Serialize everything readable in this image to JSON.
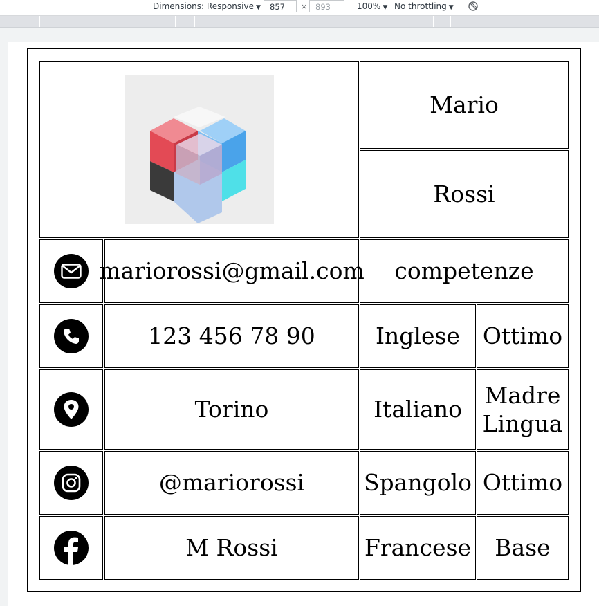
{
  "devtools": {
    "dimensions_label": "Dimensions: Responsive",
    "width_value": "857",
    "height_placeholder": "893",
    "times": "×",
    "zoom": "100%",
    "throttling": "No throttling",
    "caret": "▼"
  },
  "profile": {
    "first_name": "Mario",
    "last_name": "Rossi",
    "photo_icon": "glass-cube-image"
  },
  "contacts": [
    {
      "icon": "email-icon",
      "value": "mariorossi@gmail.com"
    },
    {
      "icon": "phone-icon",
      "value": "123 456 78 90"
    },
    {
      "icon": "location-icon",
      "value": "Torino"
    },
    {
      "icon": "instagram-icon",
      "value": "@mariorossi"
    },
    {
      "icon": "facebook-icon",
      "value": "M Rossi"
    }
  ],
  "skills": {
    "header": "competenze",
    "languages": [
      {
        "language": "Inglese",
        "level": "Ottimo"
      },
      {
        "language": "Italiano",
        "level": "Madre Lingua"
      },
      {
        "language": "Spangolo",
        "level": "Ottimo"
      },
      {
        "language": "Francese",
        "level": "Base"
      }
    ]
  },
  "colors": {
    "border": "#000000",
    "toolbar_bg": "#ffffff",
    "ruler_bg": "#dfe1e5",
    "page_bg": "#f1f3f4"
  }
}
